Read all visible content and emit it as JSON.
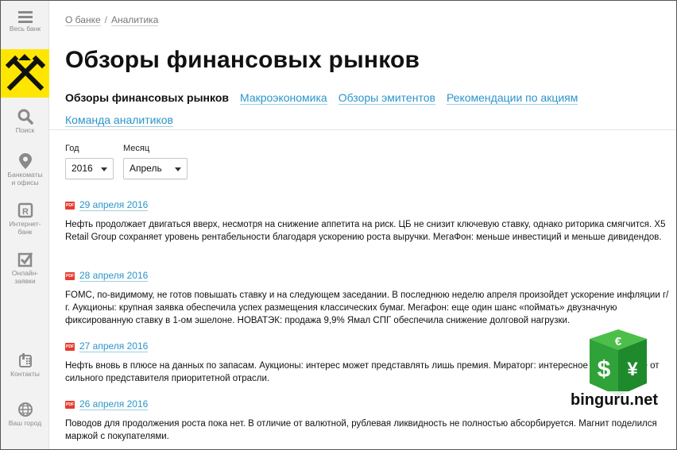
{
  "sidebar": {
    "menu_label": "Весь банк",
    "items": [
      {
        "label": "Поиск",
        "icon": "search-icon"
      },
      {
        "label": "Банкоматы\nи офисы",
        "icon": "location-pin-icon"
      },
      {
        "label": "Интернет-\nбанк",
        "icon": "internet-bank-icon"
      },
      {
        "label": "Онлайн-\nзаявки",
        "icon": "checkbox-icon"
      },
      {
        "label": "Контакты",
        "icon": "phone-icon"
      },
      {
        "label": "Ваш город",
        "icon": "globe-icon"
      }
    ],
    "logo_color": "#fee600"
  },
  "breadcrumb": [
    "О банке",
    "Аналитика"
  ],
  "page_title": "Обзоры финансовых рынков",
  "tabs": [
    {
      "label": "Обзоры финансовых рынков",
      "active": true
    },
    {
      "label": "Макроэкономика",
      "active": false
    },
    {
      "label": "Обзоры эмитентов",
      "active": false
    },
    {
      "label": "Рекомендации по акциям",
      "active": false
    },
    {
      "label": "Команда аналитиков",
      "active": false
    }
  ],
  "filters": {
    "year": {
      "label": "Год",
      "value": "2016"
    },
    "month": {
      "label": "Месяц",
      "value": "Апрель"
    }
  },
  "news": [
    {
      "date": "29 апреля 2016",
      "text": "Нефть продолжает двигаться вверх, несмотря на снижение аппетита на риск. ЦБ не снизит ключевую ставку, однако риторика смягчится. X5 Retail Group сохраняет уровень рентабельности благодаря ускорению роста выручки. МегаФон: меньше инвестиций и меньше дивидендов."
    },
    {
      "date": "28 апреля 2016",
      "text": "FOMC, по-видимому, не готов повышать ставку и на следующем заседании. В последнюю неделю апреля произойдет ускорение инфляции г/г. Аукционы: крупная заявка обеспечила успех размещения классических бумаг. Мегафон: еще один шанс «поймать» двузначную фиксированную ставку в 1-ом эшелоне. НОВАТЭК: продажа 9,9% Ямал СПГ обеспечила снижение долговой нагрузки."
    },
    {
      "date": "27 апреля 2016",
      "text": "Нефть вновь в плюсе на данных по запасам. Аукционы: интерес может представлять лишь премия. Мираторг: интересное предложение от сильного представителя приоритетной отрасли."
    },
    {
      "date": "26 апреля 2016",
      "text": "Поводов для продолжения роста пока нет. В отличие от валютной, рублевая ликвидность не полностью абсорбируется. Магнит поделился маржой с покупателями."
    }
  ],
  "pdf_badge": "PDF",
  "watermark": {
    "text": "binguru.net",
    "symbols": [
      "€",
      "$",
      "¥"
    ],
    "color": "#2fa23a"
  },
  "accent_color": "#2b94c9"
}
